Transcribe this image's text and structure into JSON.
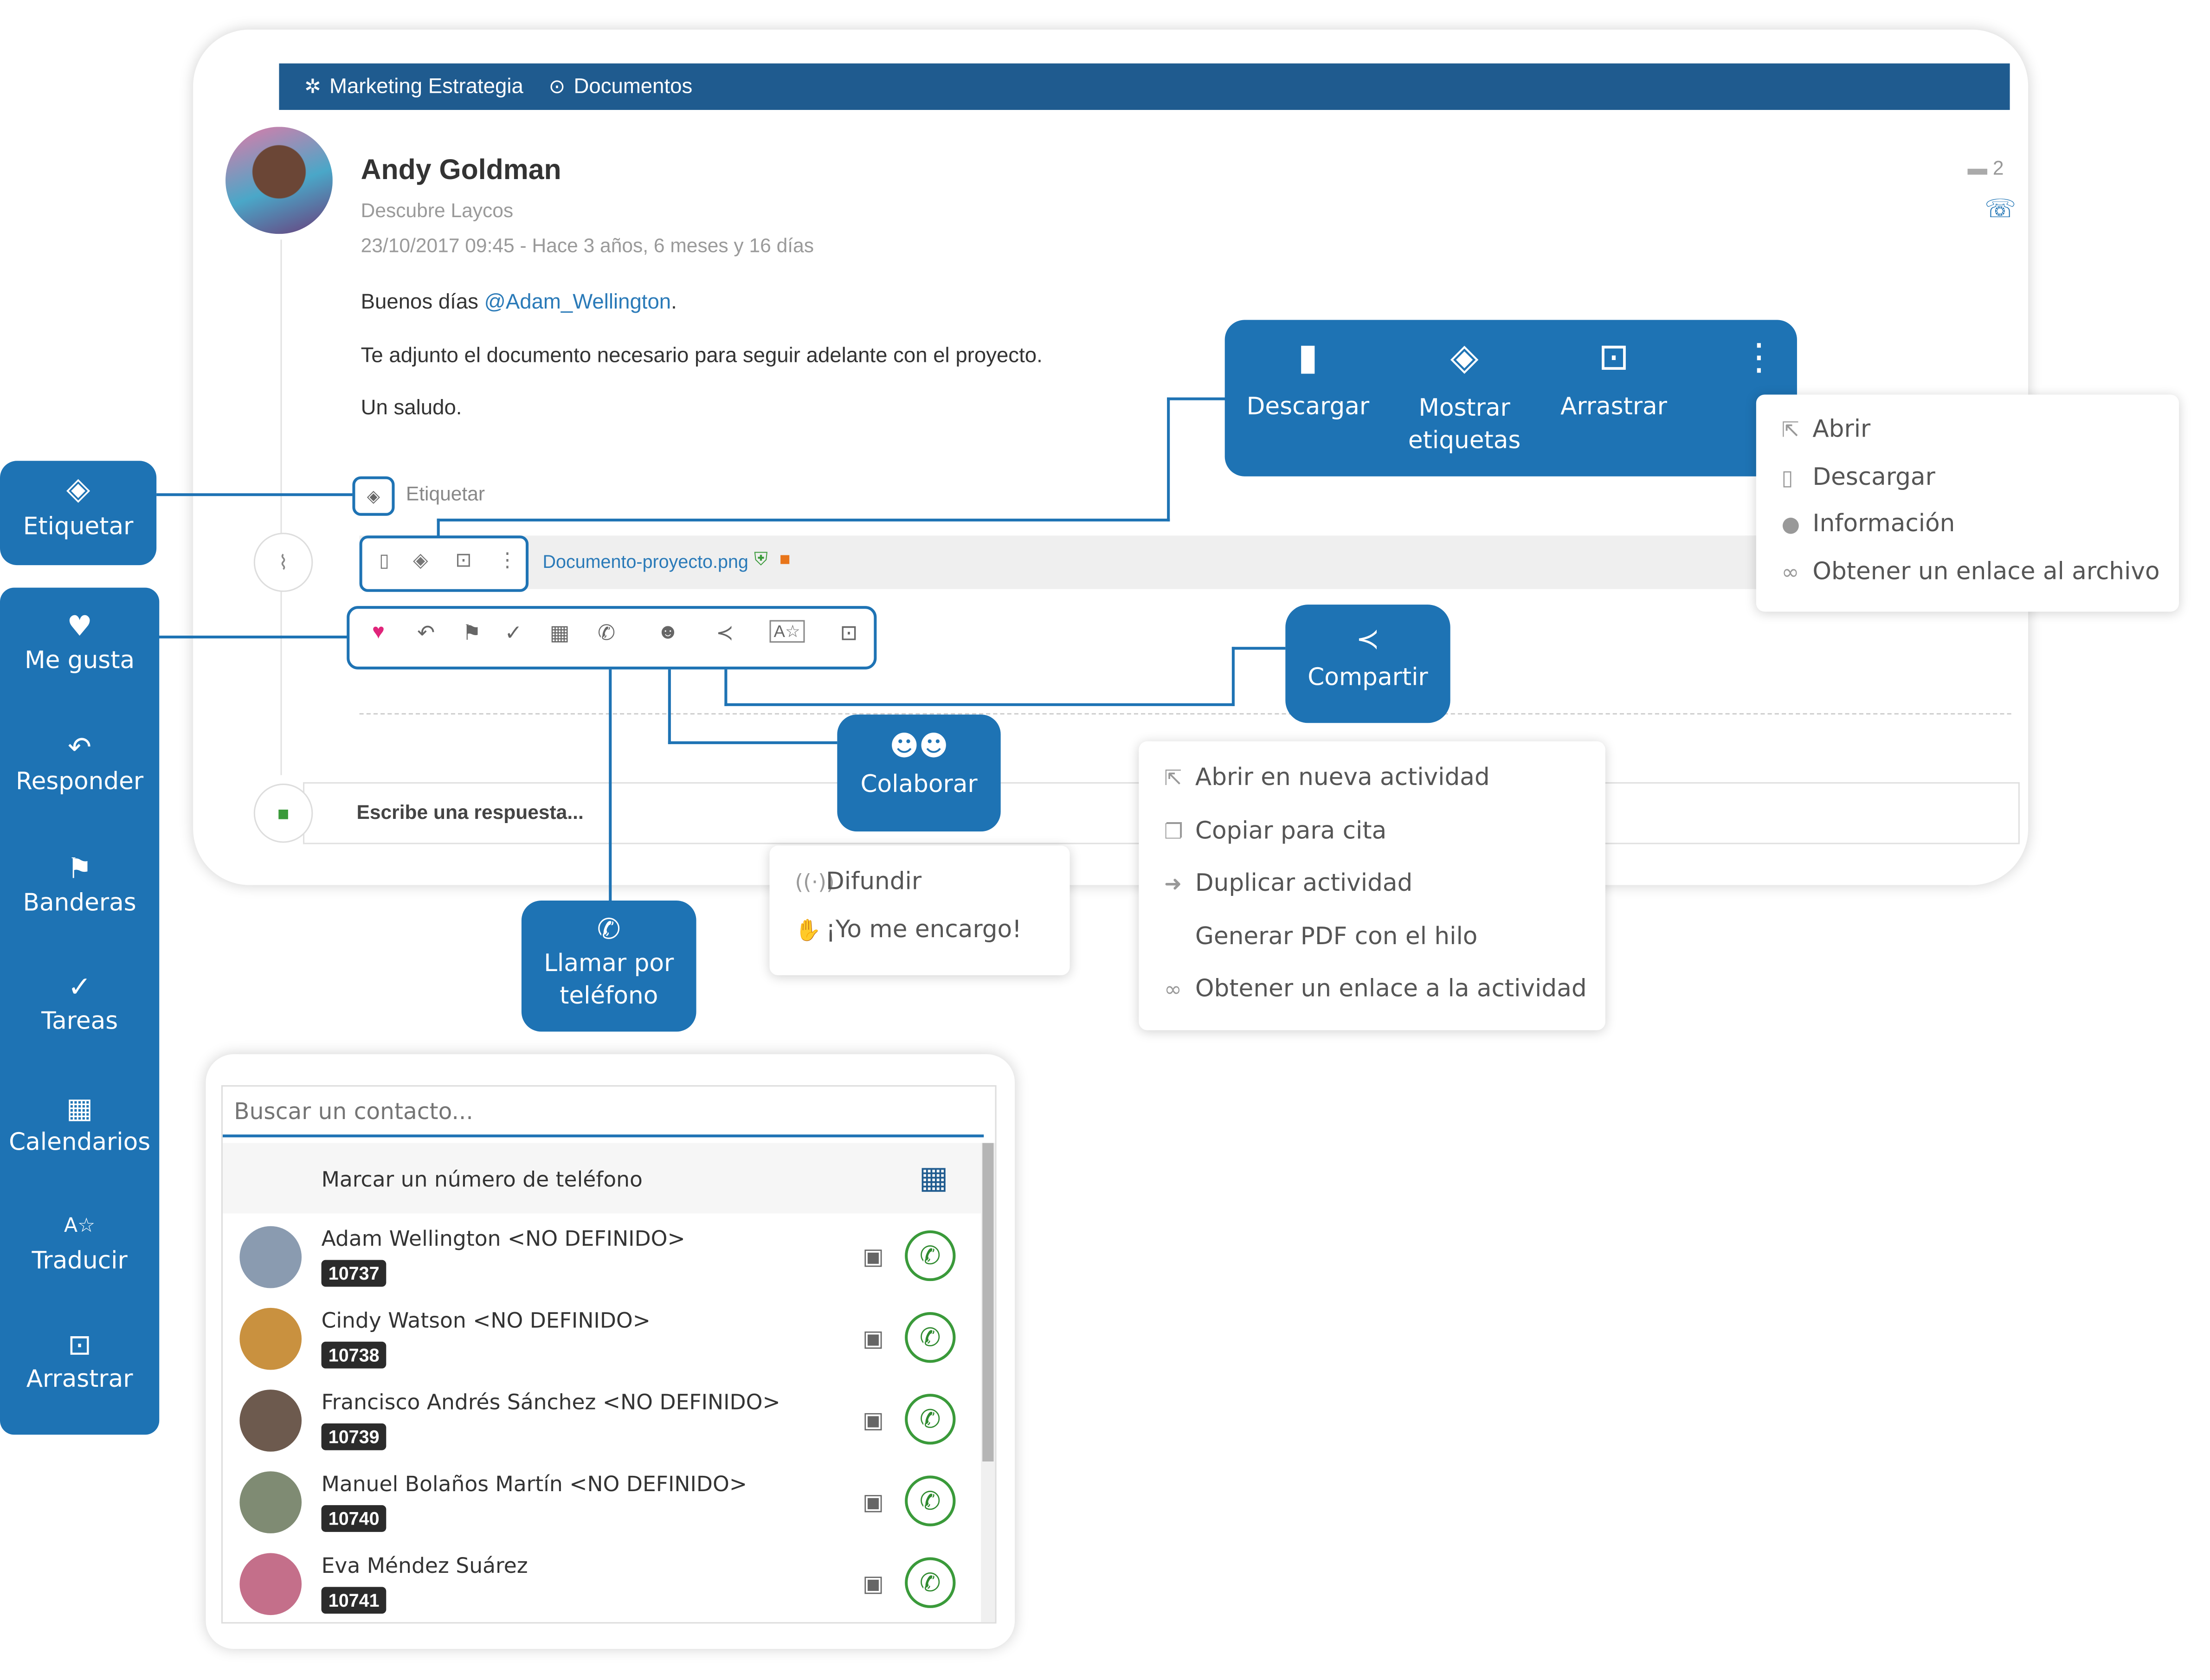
{
  "topbar": {
    "project": "Marketing Estrategia",
    "section": "Documentos"
  },
  "post": {
    "author": "Andy Goldman",
    "subtitle": "Descubre Laycos",
    "date": "23/10/2017 09:45 - Hace 3 años, 6 meses y 16 días",
    "greeting": "Buenos días ",
    "mention": "@Adam_Wellington",
    "greeting_end": ".",
    "line2": "Te adjunto el documento necesario para seguir adelante con el proyecto.",
    "line3": "Un saludo.",
    "comment_count": "2",
    "tag_label": "Etiquetar",
    "attachment_name": "Documento-proyecto.png",
    "reply_placeholder": "Escribe una respuesta..."
  },
  "doc_actions": {
    "descargar": "Descargar",
    "mostrar_etiquetas_1": "Mostrar",
    "mostrar_etiquetas_2": "etiquetas",
    "arrastrar": "Arrastrar"
  },
  "file_menu": [
    "Abrir",
    "Descargar",
    "Información",
    "Obtener un enlace al archivo"
  ],
  "sidebar": [
    {
      "label": "Etiquetar",
      "icon": "tags-icon"
    },
    {
      "label": "Me gusta",
      "icon": "heart-icon"
    },
    {
      "label": "Responder",
      "icon": "reply-icon"
    },
    {
      "label": "Banderas",
      "icon": "flag-icon"
    },
    {
      "label": "Tareas",
      "icon": "check-icon"
    },
    {
      "label": "Calendarios",
      "icon": "calendar-icon"
    },
    {
      "label": "Traducir",
      "icon": "translate-icon"
    },
    {
      "label": "Arrastrar",
      "icon": "drag-icon"
    }
  ],
  "callouts": {
    "compartir": "Compartir",
    "colaborar": "Colaborar",
    "llamar_1": "Llamar por",
    "llamar_2": "teléfono"
  },
  "share_menu": [
    "Abrir en nueva actividad",
    "Copiar para cita",
    "Duplicar actividad",
    "Generar PDF con el hilo",
    "Obtener un enlace a la actividad"
  ],
  "collab_menu": [
    "Difundir",
    "¡Yo me encargo!"
  ],
  "contacts": {
    "search_placeholder": "Buscar un contacto...",
    "dial_label": "Marcar un número de teléfono",
    "rows": [
      {
        "name": "Adam Wellington <NO DEFINIDO>",
        "ext": "10737",
        "color": "#8a9bb0"
      },
      {
        "name": "Cindy Watson <NO DEFINIDO>",
        "ext": "10738",
        "color": "#c9913f"
      },
      {
        "name": "Francisco Andrés Sánchez <NO DEFINIDO>",
        "ext": "10739",
        "color": "#6d5a4e"
      },
      {
        "name": "Manuel Bolaños Martín <NO DEFINIDO>",
        "ext": "10740",
        "color": "#7f8b73"
      },
      {
        "name": "Eva Méndez Suárez",
        "ext": "10741",
        "color": "#c46f8a"
      }
    ]
  },
  "colors": {
    "accent": "#1e73b4",
    "topbar": "#1f5b8f",
    "like": "#e0247a",
    "call": "#2f8a2f"
  }
}
